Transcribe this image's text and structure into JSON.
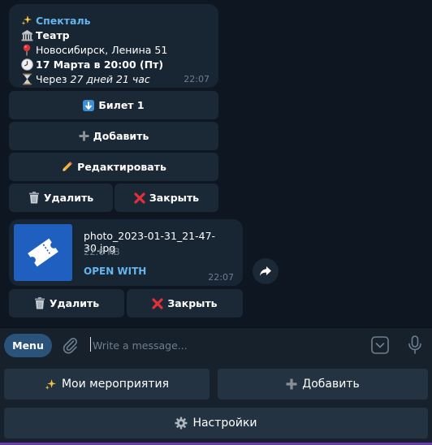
{
  "event_message": {
    "title": "Спекталь",
    "place": "Театр",
    "address": "Новосибирск, Ленина 51",
    "datetime": "17 Марта в 20:00 (Пт)",
    "countdown_prefix": "Через ",
    "countdown_value": "27 дней 21 час",
    "time": "22:07",
    "icons": [
      "sparkles-icon",
      "classical-building-icon",
      "round-pushpin-icon",
      "clock-icon",
      "hourglass-icon"
    ],
    "keyboard": {
      "ticket": "Билет 1",
      "add": "Добавить",
      "edit": "Редактировать",
      "delete": "Удалить",
      "close": "Закрыть"
    }
  },
  "file_message": {
    "filename": "photo_2023-01-31_21-47-30.jpg",
    "size": "22.6 KB",
    "open_with": "OPEN WITH",
    "time": "22:07",
    "keyboard": {
      "delete": "Удалить",
      "close": "Закрыть"
    }
  },
  "composer": {
    "menu_label": "Menu",
    "placeholder": "Write a message..."
  },
  "reply_keyboard": {
    "my_events": "Мои мероприятия",
    "add": "Добавить",
    "settings": "Настройки"
  },
  "colors": {
    "background": "#0e1621",
    "bubble": "#182533",
    "accent": "#64b5ef",
    "menu_button": "#2b5278",
    "composer": "#17212b",
    "red_cross": "#e0303a"
  }
}
